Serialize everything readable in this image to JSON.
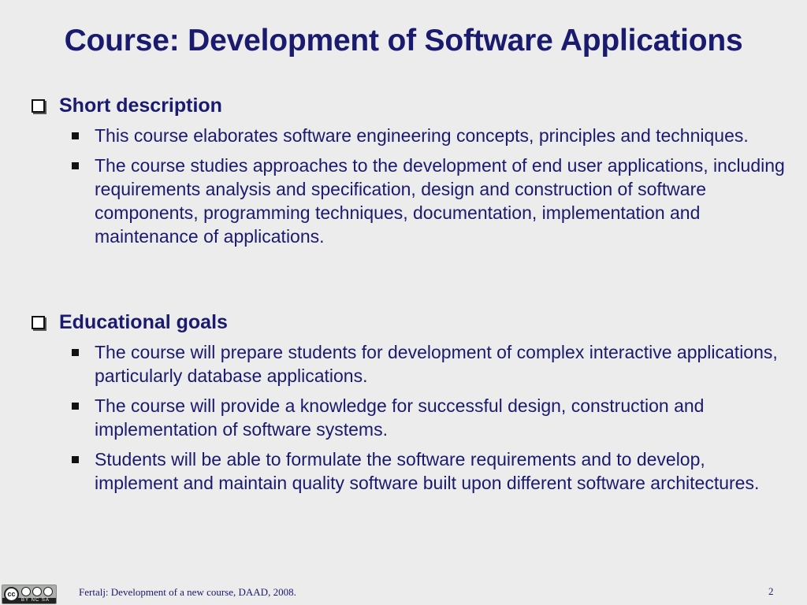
{
  "slide": {
    "title": "Course: Development of Software Applications"
  },
  "sections": [
    {
      "heading": "Short description",
      "bullets": [
        "This course elaborates software engineering concepts, principles and techniques.",
        "The course studies approaches to the development of end user applications, including requirements analysis and specification, design and construction of software components, programming techniques, documentation, implementation and maintenance of applications."
      ]
    },
    {
      "heading": "Educational goals",
      "bullets": [
        "The course will prepare students for development of complex interactive applications, particularly database applications.",
        "The course will provide a knowledge for successful design, construction and implementation of software systems.",
        "Students will be able to formulate the software requirements and to develop, implement and maintain quality software built upon different software architectures."
      ]
    }
  ],
  "footer": {
    "text": "Fertalj: Development of a new course, DAAD, 2008.",
    "page_number": "2",
    "license_badge": {
      "icon": "creative-commons-by-nc-sa-icon",
      "label": "cc",
      "terms": "BY NC SA"
    }
  },
  "colors": {
    "background": "#ececec",
    "text": "#1a1a6e"
  }
}
